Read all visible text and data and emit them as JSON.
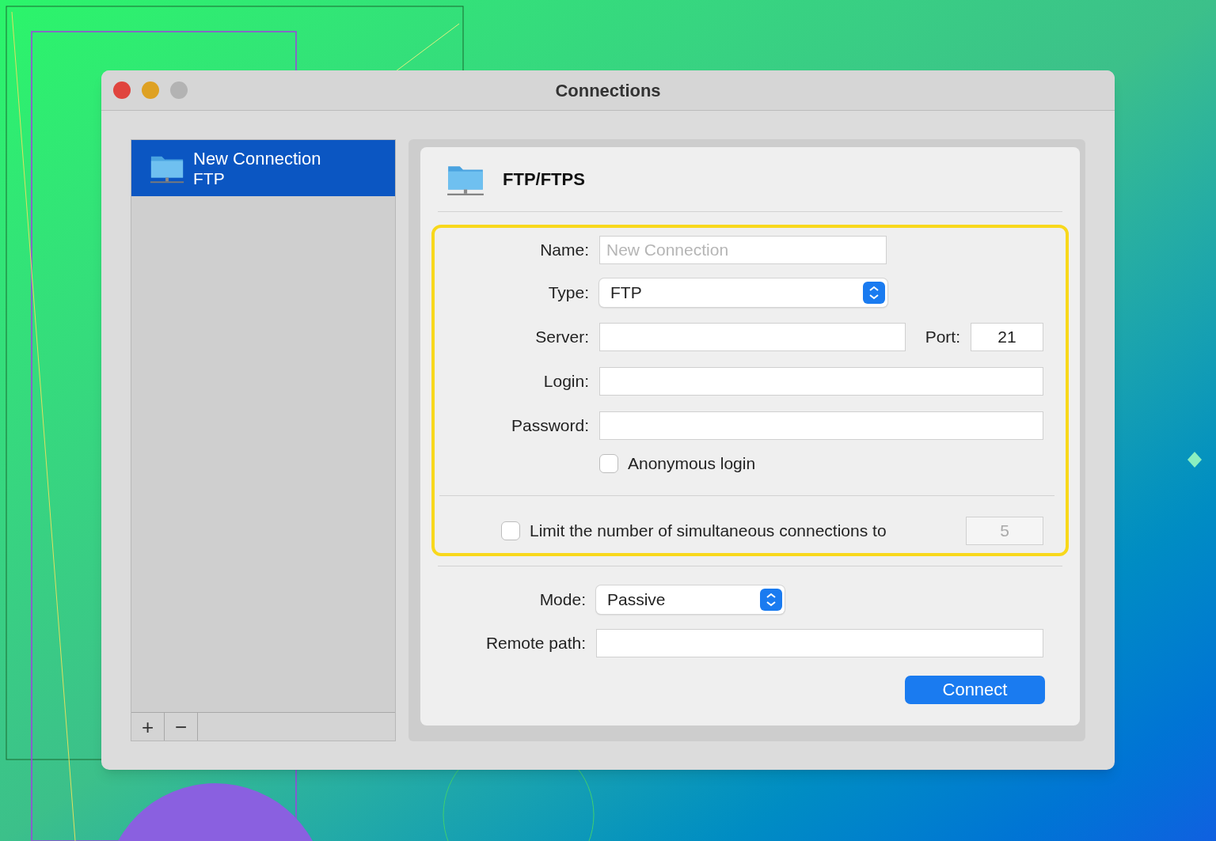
{
  "window": {
    "title": "Connections"
  },
  "sidebar": {
    "items": [
      {
        "name": "New Connection",
        "type": "FTP",
        "selected": true
      }
    ],
    "buttons": [
      "+",
      "−"
    ]
  },
  "panel": {
    "title": "FTP/FTPS",
    "form": {
      "highlighted": true,
      "name": {
        "label": "Name:",
        "placeholder": "New Connection"
      },
      "type": {
        "label": "Type:",
        "value": "FTP"
      },
      "server": {
        "label": "Server:"
      },
      "port": {
        "label": "Port:",
        "value": "21"
      },
      "login": {
        "label": "Login:"
      },
      "password": {
        "label": "Password:"
      },
      "anonymous": {
        "label": "Anonymous login",
        "checked": false
      },
      "limit": {
        "label": "Limit the number of simultaneous connections to",
        "checked": false,
        "value": "5",
        "disabled": true
      }
    },
    "mode": {
      "label": "Mode:",
      "value": "Passive"
    },
    "remote_path": {
      "label": "Remote path:"
    },
    "connect_button": "Connect"
  }
}
